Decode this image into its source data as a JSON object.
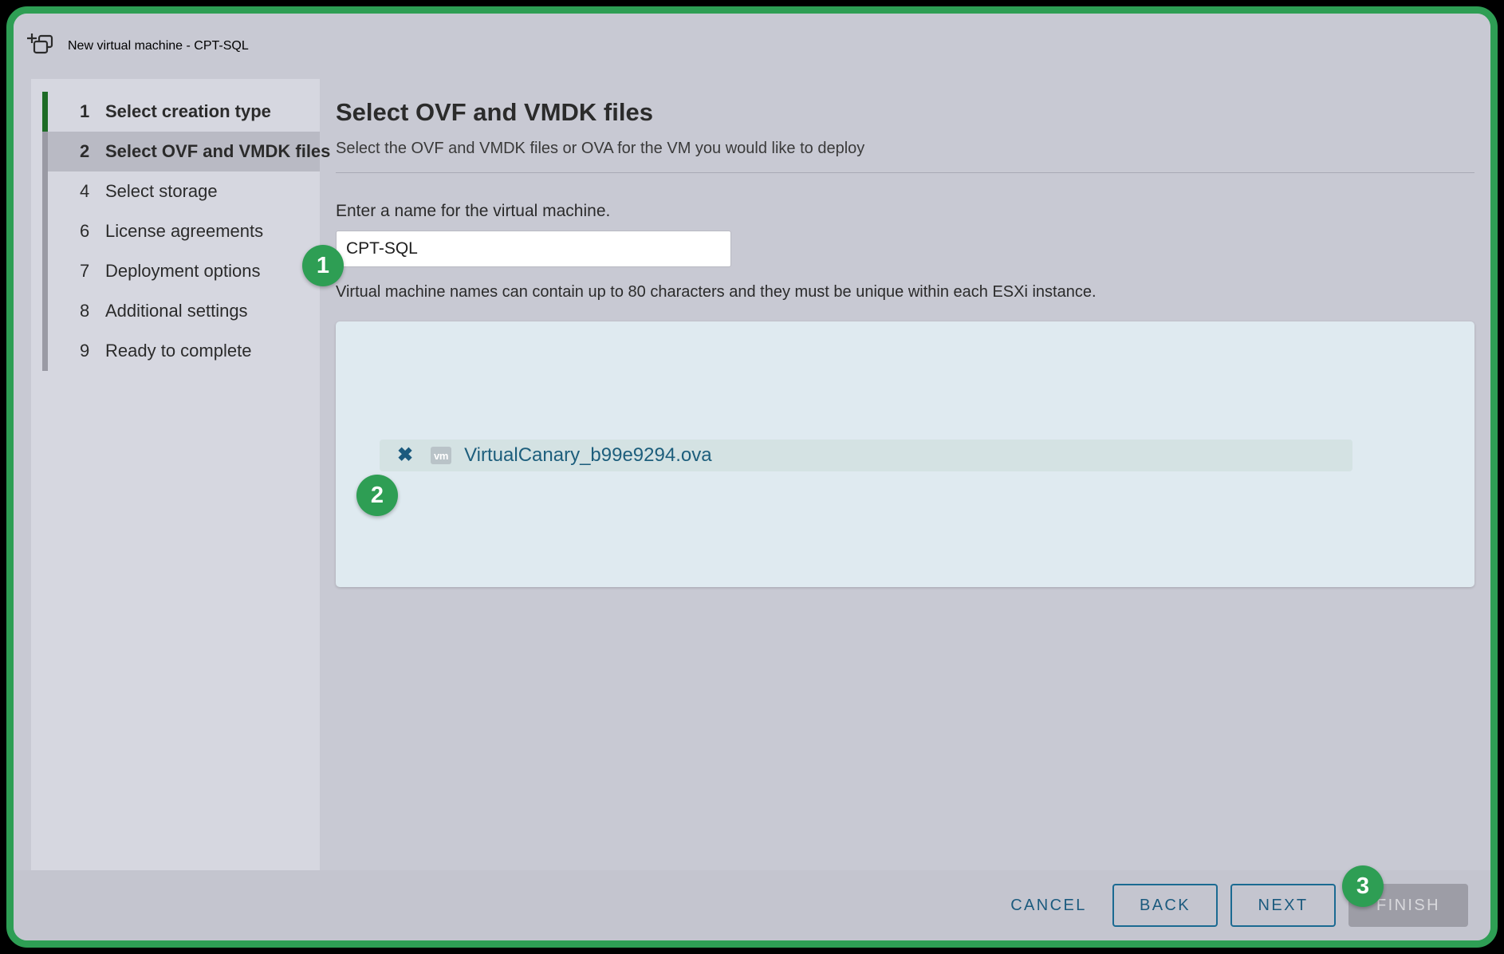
{
  "window": {
    "title": "New virtual machine - CPT-SQL",
    "icon": "new-vm-icon"
  },
  "sidebar": {
    "steps": [
      {
        "num": "1",
        "label": "Select creation type",
        "state": "done"
      },
      {
        "num": "2",
        "label": "Select OVF and VMDK files",
        "state": "active"
      },
      {
        "num": "4",
        "label": "Select storage",
        "state": "pending"
      },
      {
        "num": "6",
        "label": "License agreements",
        "state": "pending"
      },
      {
        "num": "7",
        "label": "Deployment options",
        "state": "pending"
      },
      {
        "num": "8",
        "label": "Additional settings",
        "state": "pending"
      },
      {
        "num": "9",
        "label": "Ready to complete",
        "state": "pending"
      }
    ]
  },
  "main": {
    "title": "Select OVF and VMDK files",
    "subtitle": "Select the OVF and VMDK files or OVA for the VM you would like to deploy",
    "name_label": "Enter a name for the virtual machine.",
    "name_value": "CPT-SQL",
    "name_placeholder": "Enter a name for the virtual machine",
    "name_hint": "Virtual machine names can contain up to 80 characters and they must be unique within each ESXi instance.",
    "file": {
      "remove_glyph": "✖",
      "type_badge": "vm",
      "name": "VirtualCanary_b99e9294.ova"
    }
  },
  "footer": {
    "cancel_label": "CANCEL",
    "back_label": "BACK",
    "next_label": "NEXT",
    "finish_label": "FINISH"
  },
  "annotations": {
    "badge1": "1",
    "badge2": "2",
    "badge3": "3"
  },
  "colors": {
    "accent_green": "#2e9e54",
    "step_done": "#1d6b26",
    "link_blue": "#1b5a7e",
    "dropzone_bg": "#dfeaf0",
    "dialog_bg": "#c8c9d3"
  }
}
